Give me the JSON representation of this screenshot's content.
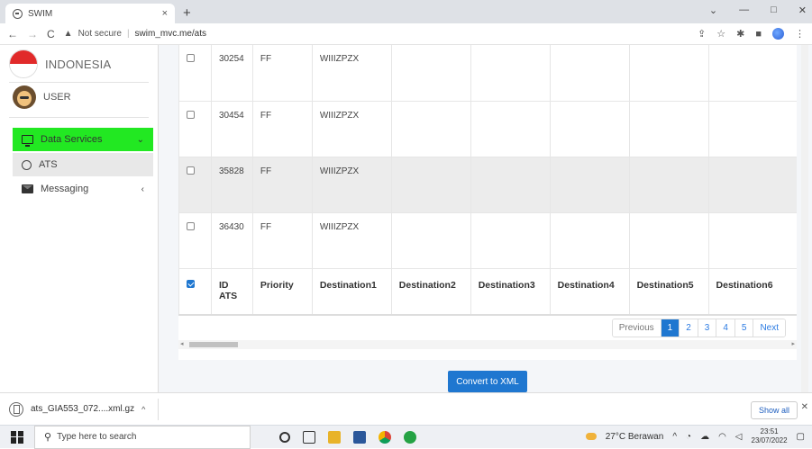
{
  "browser": {
    "tab_title": "SWIM",
    "tab_close": "×",
    "new_tab": "+",
    "security_label": "Not secure",
    "url": "swim_mvc.me/ats",
    "win_minimize": "—",
    "win_maximize": "□",
    "win_close": "✕"
  },
  "sidebar": {
    "brand": "INDONESIA",
    "user": "USER",
    "items": [
      {
        "label": "Data Services",
        "icon": "monitor-icon",
        "chevron": "⌄",
        "active": true
      },
      {
        "label": "ATS",
        "icon": "circle-icon"
      },
      {
        "label": "Messaging",
        "icon": "envelope-icon",
        "chevron": "‹"
      }
    ]
  },
  "table": {
    "rows": [
      {
        "id": "30254",
        "priority": "FF",
        "destination1": "WIIIZPZX"
      },
      {
        "id": "30454",
        "priority": "FF",
        "destination1": "WIIIZPZX"
      },
      {
        "id": "35828",
        "priority": "FF",
        "destination1": "WIIIZPZX"
      },
      {
        "id": "36430",
        "priority": "FF",
        "destination1": "WIIIZPZX"
      }
    ],
    "headers": {
      "id_line1": "ID",
      "id_line2": "ATS",
      "priority": "Priority",
      "destination1": "Destination1",
      "destination2": "Destination2",
      "destination3": "Destination3",
      "destination4": "Destination4",
      "destination5": "Destination5",
      "destination6": "Destination6"
    }
  },
  "pagination": {
    "previous": "Previous",
    "pages": [
      "1",
      "2",
      "3",
      "4",
      "5"
    ],
    "current": "1",
    "next": "Next"
  },
  "actions": {
    "convert": "Convert to XML"
  },
  "download": {
    "filename": "ats_GIA553_072....xml.gz",
    "chevron": "^",
    "show_all": "Show all",
    "close": "✕"
  },
  "taskbar": {
    "search_placeholder": "Type here to search",
    "weather": "27°C  Berawan",
    "tray_chevron": "^",
    "time": "23:51",
    "date": "23/07/2022"
  },
  "colors": {
    "active_nav": "#22e822",
    "primary": "#1f77d0"
  }
}
